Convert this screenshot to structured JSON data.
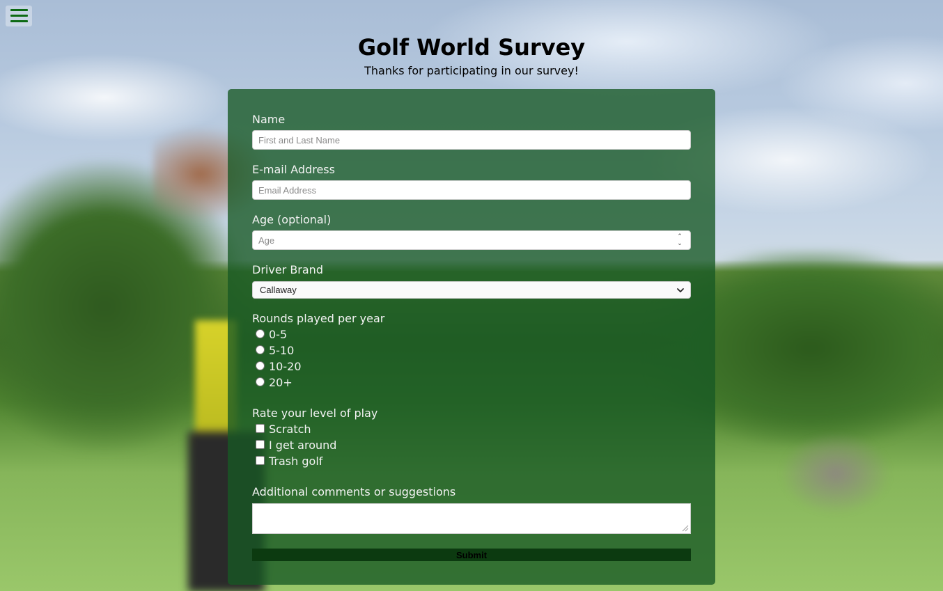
{
  "header": {
    "title": "Golf World Survey",
    "subtitle": "Thanks for participating in our survey!"
  },
  "nav": {
    "menu_icon": "hamburger-menu-icon",
    "accent_color": "#0c6a14"
  },
  "form": {
    "panel_color": "#175824",
    "name": {
      "label": "Name",
      "placeholder": "First and Last Name",
      "value": ""
    },
    "email": {
      "label": "E-mail Address",
      "placeholder": "Email Address",
      "value": ""
    },
    "age": {
      "label": "Age (optional)",
      "placeholder": "Age",
      "value": ""
    },
    "driver_brand": {
      "label": "Driver Brand",
      "selected": "Callaway"
    },
    "rounds": {
      "label": "Rounds played per year",
      "options": [
        "0-5",
        "5-10",
        "10-20",
        "20+"
      ]
    },
    "level": {
      "label": "Rate your level of play",
      "options": [
        "Scratch",
        "I get around",
        "Trash golf"
      ]
    },
    "comments": {
      "label": "Additional comments or suggestions",
      "value": ""
    },
    "submit_label": "Submit"
  }
}
